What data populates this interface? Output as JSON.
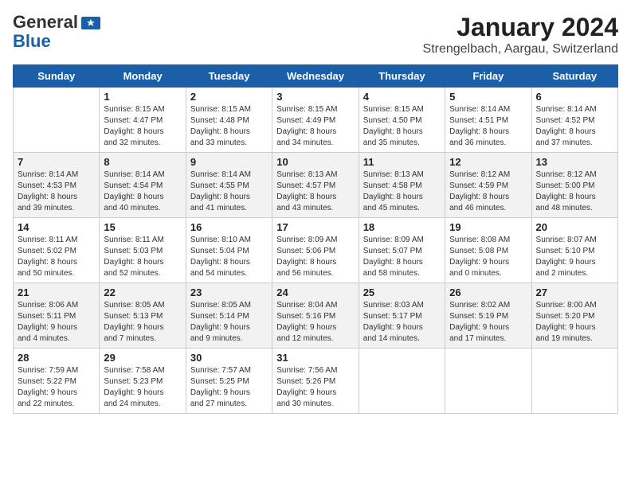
{
  "header": {
    "logo_general": "General",
    "logo_blue": "Blue",
    "title": "January 2024",
    "subtitle": "Strengelbach, Aargau, Switzerland"
  },
  "days_of_week": [
    "Sunday",
    "Monday",
    "Tuesday",
    "Wednesday",
    "Thursday",
    "Friday",
    "Saturday"
  ],
  "weeks": [
    [
      {
        "day": "",
        "info": ""
      },
      {
        "day": "1",
        "info": "Sunrise: 8:15 AM\nSunset: 4:47 PM\nDaylight: 8 hours\nand 32 minutes."
      },
      {
        "day": "2",
        "info": "Sunrise: 8:15 AM\nSunset: 4:48 PM\nDaylight: 8 hours\nand 33 minutes."
      },
      {
        "day": "3",
        "info": "Sunrise: 8:15 AM\nSunset: 4:49 PM\nDaylight: 8 hours\nand 34 minutes."
      },
      {
        "day": "4",
        "info": "Sunrise: 8:15 AM\nSunset: 4:50 PM\nDaylight: 8 hours\nand 35 minutes."
      },
      {
        "day": "5",
        "info": "Sunrise: 8:14 AM\nSunset: 4:51 PM\nDaylight: 8 hours\nand 36 minutes."
      },
      {
        "day": "6",
        "info": "Sunrise: 8:14 AM\nSunset: 4:52 PM\nDaylight: 8 hours\nand 37 minutes."
      }
    ],
    [
      {
        "day": "7",
        "info": "Sunrise: 8:14 AM\nSunset: 4:53 PM\nDaylight: 8 hours\nand 39 minutes."
      },
      {
        "day": "8",
        "info": "Sunrise: 8:14 AM\nSunset: 4:54 PM\nDaylight: 8 hours\nand 40 minutes."
      },
      {
        "day": "9",
        "info": "Sunrise: 8:14 AM\nSunset: 4:55 PM\nDaylight: 8 hours\nand 41 minutes."
      },
      {
        "day": "10",
        "info": "Sunrise: 8:13 AM\nSunset: 4:57 PM\nDaylight: 8 hours\nand 43 minutes."
      },
      {
        "day": "11",
        "info": "Sunrise: 8:13 AM\nSunset: 4:58 PM\nDaylight: 8 hours\nand 45 minutes."
      },
      {
        "day": "12",
        "info": "Sunrise: 8:12 AM\nSunset: 4:59 PM\nDaylight: 8 hours\nand 46 minutes."
      },
      {
        "day": "13",
        "info": "Sunrise: 8:12 AM\nSunset: 5:00 PM\nDaylight: 8 hours\nand 48 minutes."
      }
    ],
    [
      {
        "day": "14",
        "info": "Sunrise: 8:11 AM\nSunset: 5:02 PM\nDaylight: 8 hours\nand 50 minutes."
      },
      {
        "day": "15",
        "info": "Sunrise: 8:11 AM\nSunset: 5:03 PM\nDaylight: 8 hours\nand 52 minutes."
      },
      {
        "day": "16",
        "info": "Sunrise: 8:10 AM\nSunset: 5:04 PM\nDaylight: 8 hours\nand 54 minutes."
      },
      {
        "day": "17",
        "info": "Sunrise: 8:09 AM\nSunset: 5:06 PM\nDaylight: 8 hours\nand 56 minutes."
      },
      {
        "day": "18",
        "info": "Sunrise: 8:09 AM\nSunset: 5:07 PM\nDaylight: 8 hours\nand 58 minutes."
      },
      {
        "day": "19",
        "info": "Sunrise: 8:08 AM\nSunset: 5:08 PM\nDaylight: 9 hours\nand 0 minutes."
      },
      {
        "day": "20",
        "info": "Sunrise: 8:07 AM\nSunset: 5:10 PM\nDaylight: 9 hours\nand 2 minutes."
      }
    ],
    [
      {
        "day": "21",
        "info": "Sunrise: 8:06 AM\nSunset: 5:11 PM\nDaylight: 9 hours\nand 4 minutes."
      },
      {
        "day": "22",
        "info": "Sunrise: 8:05 AM\nSunset: 5:13 PM\nDaylight: 9 hours\nand 7 minutes."
      },
      {
        "day": "23",
        "info": "Sunrise: 8:05 AM\nSunset: 5:14 PM\nDaylight: 9 hours\nand 9 minutes."
      },
      {
        "day": "24",
        "info": "Sunrise: 8:04 AM\nSunset: 5:16 PM\nDaylight: 9 hours\nand 12 minutes."
      },
      {
        "day": "25",
        "info": "Sunrise: 8:03 AM\nSunset: 5:17 PM\nDaylight: 9 hours\nand 14 minutes."
      },
      {
        "day": "26",
        "info": "Sunrise: 8:02 AM\nSunset: 5:19 PM\nDaylight: 9 hours\nand 17 minutes."
      },
      {
        "day": "27",
        "info": "Sunrise: 8:00 AM\nSunset: 5:20 PM\nDaylight: 9 hours\nand 19 minutes."
      }
    ],
    [
      {
        "day": "28",
        "info": "Sunrise: 7:59 AM\nSunset: 5:22 PM\nDaylight: 9 hours\nand 22 minutes."
      },
      {
        "day": "29",
        "info": "Sunrise: 7:58 AM\nSunset: 5:23 PM\nDaylight: 9 hours\nand 24 minutes."
      },
      {
        "day": "30",
        "info": "Sunrise: 7:57 AM\nSunset: 5:25 PM\nDaylight: 9 hours\nand 27 minutes."
      },
      {
        "day": "31",
        "info": "Sunrise: 7:56 AM\nSunset: 5:26 PM\nDaylight: 9 hours\nand 30 minutes."
      },
      {
        "day": "",
        "info": ""
      },
      {
        "day": "",
        "info": ""
      },
      {
        "day": "",
        "info": ""
      }
    ]
  ]
}
